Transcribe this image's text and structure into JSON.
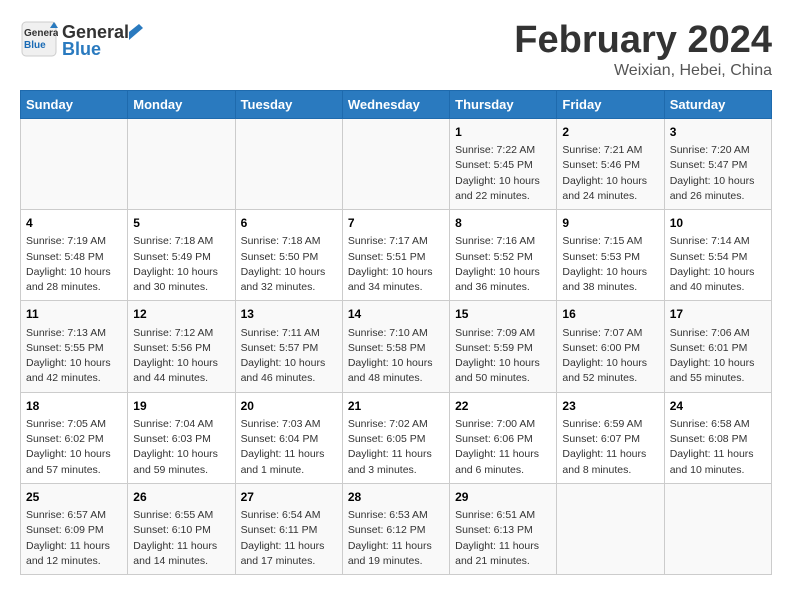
{
  "header": {
    "logo_line1": "General",
    "logo_line2": "Blue",
    "month": "February 2024",
    "location": "Weixian, Hebei, China"
  },
  "weekdays": [
    "Sunday",
    "Monday",
    "Tuesday",
    "Wednesday",
    "Thursday",
    "Friday",
    "Saturday"
  ],
  "weeks": [
    [
      {
        "day": "",
        "info": ""
      },
      {
        "day": "",
        "info": ""
      },
      {
        "day": "",
        "info": ""
      },
      {
        "day": "",
        "info": ""
      },
      {
        "day": "1",
        "info": "Sunrise: 7:22 AM\nSunset: 5:45 PM\nDaylight: 10 hours and 22 minutes."
      },
      {
        "day": "2",
        "info": "Sunrise: 7:21 AM\nSunset: 5:46 PM\nDaylight: 10 hours and 24 minutes."
      },
      {
        "day": "3",
        "info": "Sunrise: 7:20 AM\nSunset: 5:47 PM\nDaylight: 10 hours and 26 minutes."
      }
    ],
    [
      {
        "day": "4",
        "info": "Sunrise: 7:19 AM\nSunset: 5:48 PM\nDaylight: 10 hours and 28 minutes."
      },
      {
        "day": "5",
        "info": "Sunrise: 7:18 AM\nSunset: 5:49 PM\nDaylight: 10 hours and 30 minutes."
      },
      {
        "day": "6",
        "info": "Sunrise: 7:18 AM\nSunset: 5:50 PM\nDaylight: 10 hours and 32 minutes."
      },
      {
        "day": "7",
        "info": "Sunrise: 7:17 AM\nSunset: 5:51 PM\nDaylight: 10 hours and 34 minutes."
      },
      {
        "day": "8",
        "info": "Sunrise: 7:16 AM\nSunset: 5:52 PM\nDaylight: 10 hours and 36 minutes."
      },
      {
        "day": "9",
        "info": "Sunrise: 7:15 AM\nSunset: 5:53 PM\nDaylight: 10 hours and 38 minutes."
      },
      {
        "day": "10",
        "info": "Sunrise: 7:14 AM\nSunset: 5:54 PM\nDaylight: 10 hours and 40 minutes."
      }
    ],
    [
      {
        "day": "11",
        "info": "Sunrise: 7:13 AM\nSunset: 5:55 PM\nDaylight: 10 hours and 42 minutes."
      },
      {
        "day": "12",
        "info": "Sunrise: 7:12 AM\nSunset: 5:56 PM\nDaylight: 10 hours and 44 minutes."
      },
      {
        "day": "13",
        "info": "Sunrise: 7:11 AM\nSunset: 5:57 PM\nDaylight: 10 hours and 46 minutes."
      },
      {
        "day": "14",
        "info": "Sunrise: 7:10 AM\nSunset: 5:58 PM\nDaylight: 10 hours and 48 minutes."
      },
      {
        "day": "15",
        "info": "Sunrise: 7:09 AM\nSunset: 5:59 PM\nDaylight: 10 hours and 50 minutes."
      },
      {
        "day": "16",
        "info": "Sunrise: 7:07 AM\nSunset: 6:00 PM\nDaylight: 10 hours and 52 minutes."
      },
      {
        "day": "17",
        "info": "Sunrise: 7:06 AM\nSunset: 6:01 PM\nDaylight: 10 hours and 55 minutes."
      }
    ],
    [
      {
        "day": "18",
        "info": "Sunrise: 7:05 AM\nSunset: 6:02 PM\nDaylight: 10 hours and 57 minutes."
      },
      {
        "day": "19",
        "info": "Sunrise: 7:04 AM\nSunset: 6:03 PM\nDaylight: 10 hours and 59 minutes."
      },
      {
        "day": "20",
        "info": "Sunrise: 7:03 AM\nSunset: 6:04 PM\nDaylight: 11 hours and 1 minute."
      },
      {
        "day": "21",
        "info": "Sunrise: 7:02 AM\nSunset: 6:05 PM\nDaylight: 11 hours and 3 minutes."
      },
      {
        "day": "22",
        "info": "Sunrise: 7:00 AM\nSunset: 6:06 PM\nDaylight: 11 hours and 6 minutes."
      },
      {
        "day": "23",
        "info": "Sunrise: 6:59 AM\nSunset: 6:07 PM\nDaylight: 11 hours and 8 minutes."
      },
      {
        "day": "24",
        "info": "Sunrise: 6:58 AM\nSunset: 6:08 PM\nDaylight: 11 hours and 10 minutes."
      }
    ],
    [
      {
        "day": "25",
        "info": "Sunrise: 6:57 AM\nSunset: 6:09 PM\nDaylight: 11 hours and 12 minutes."
      },
      {
        "day": "26",
        "info": "Sunrise: 6:55 AM\nSunset: 6:10 PM\nDaylight: 11 hours and 14 minutes."
      },
      {
        "day": "27",
        "info": "Sunrise: 6:54 AM\nSunset: 6:11 PM\nDaylight: 11 hours and 17 minutes."
      },
      {
        "day": "28",
        "info": "Sunrise: 6:53 AM\nSunset: 6:12 PM\nDaylight: 11 hours and 19 minutes."
      },
      {
        "day": "29",
        "info": "Sunrise: 6:51 AM\nSunset: 6:13 PM\nDaylight: 11 hours and 21 minutes."
      },
      {
        "day": "",
        "info": ""
      },
      {
        "day": "",
        "info": ""
      }
    ]
  ]
}
